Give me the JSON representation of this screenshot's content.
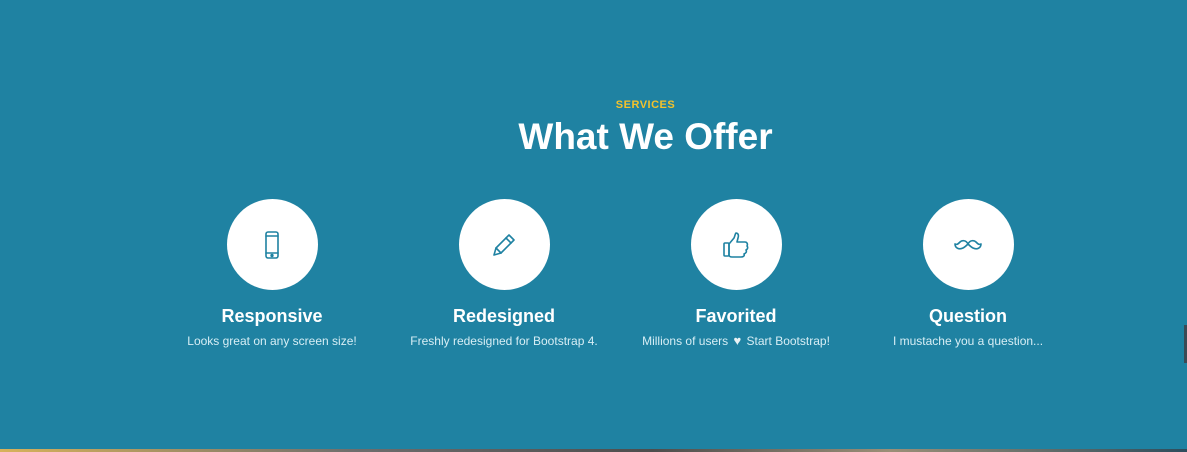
{
  "section": {
    "eyebrow": "SERVICES",
    "title": "What We Offer"
  },
  "features": [
    {
      "icon": "mobile-phone-icon",
      "title": "Responsive",
      "description": "Looks great on any screen size!"
    },
    {
      "icon": "pencil-icon",
      "title": "Redesigned",
      "description": "Freshly redesigned for Bootstrap 4."
    },
    {
      "icon": "thumbs-up-icon",
      "title": "Favorited",
      "description_before": "Millions of users",
      "description_after": "Start Bootstrap!",
      "inline_icon": "heart-icon"
    },
    {
      "icon": "mustache-icon",
      "title": "Question",
      "description": "I mustache you a question..."
    }
  ],
  "colors": {
    "background": "#1f82a2",
    "accent": "#f4c22b",
    "icon_stroke": "#1f82a2",
    "circle": "#ffffff"
  }
}
